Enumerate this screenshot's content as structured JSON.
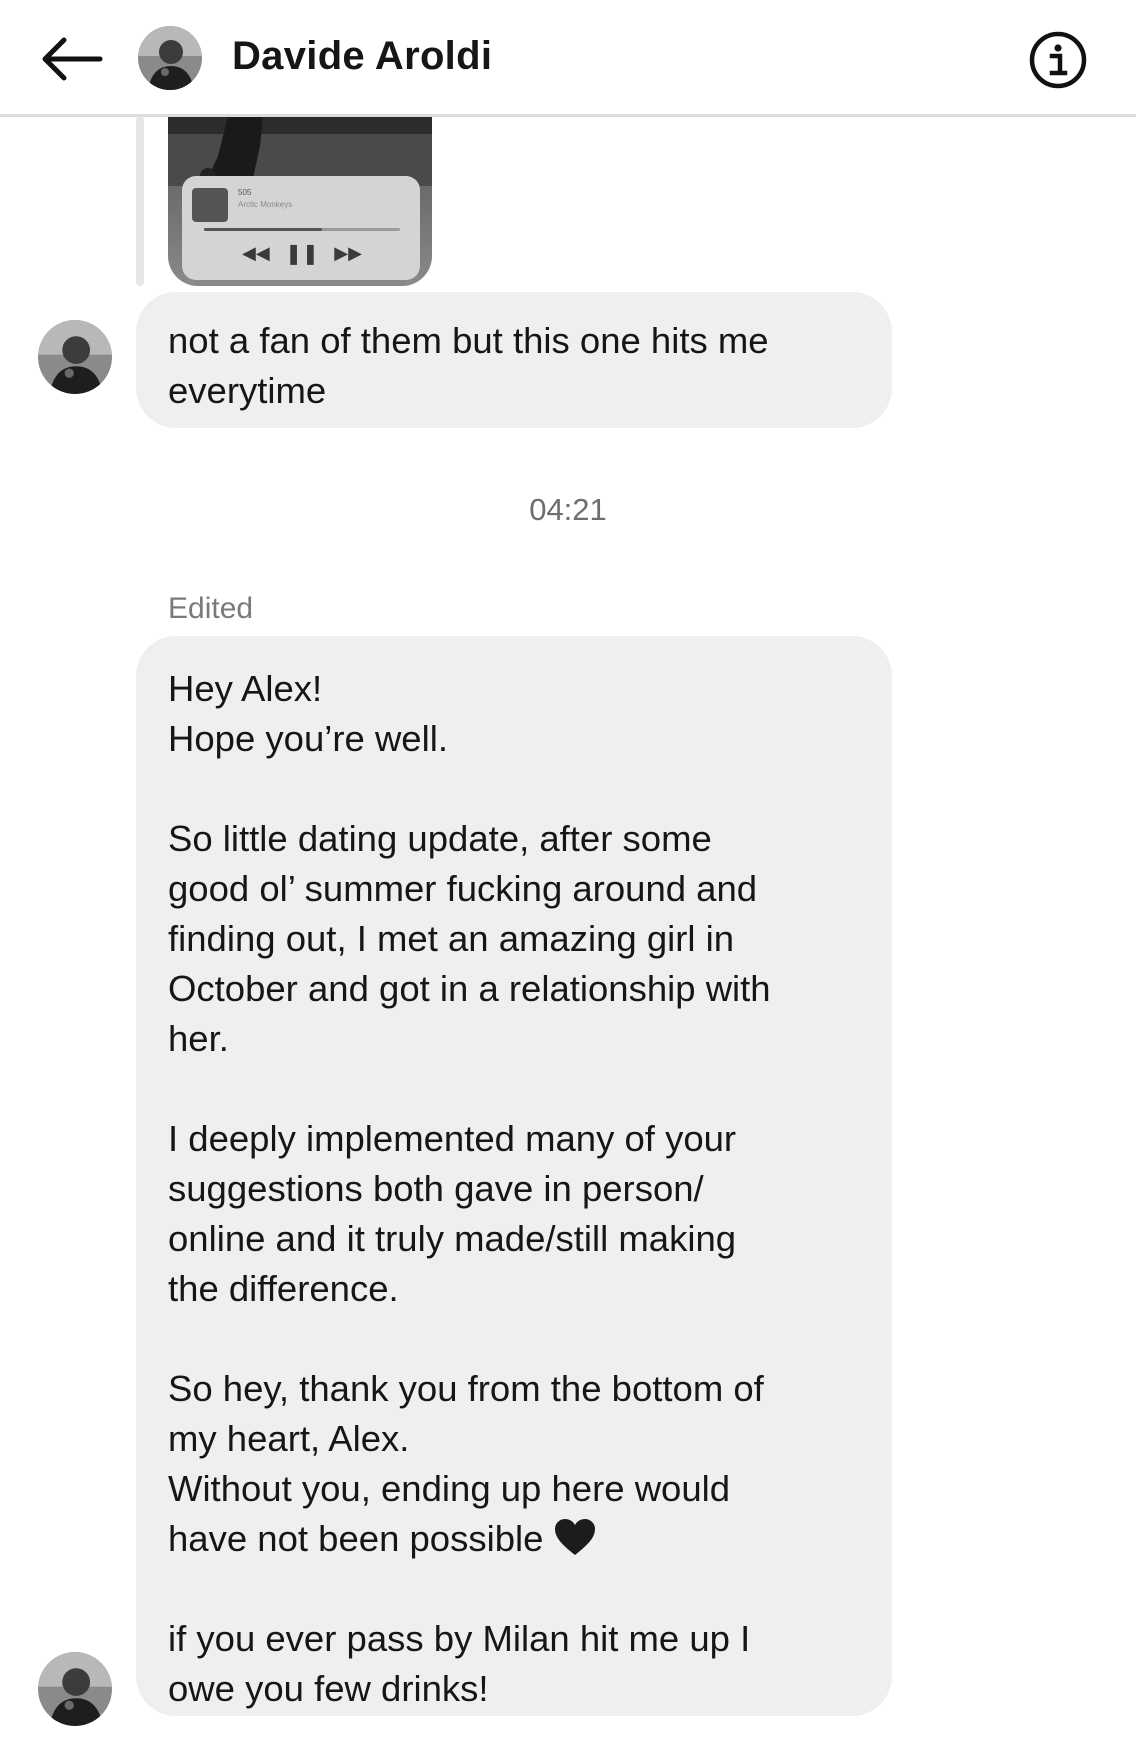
{
  "header": {
    "contact_name": "Davide Aroldi",
    "back_icon": "arrow-left-icon",
    "info_icon": "info-circle-icon"
  },
  "reply_preview": {
    "music_card": {
      "song_title": "505",
      "artist": "Arctic Monkeys",
      "progress": 0.6
    }
  },
  "messages": {
    "first": {
      "lines": [
        "not a fan of them but this one hits me",
        "everytime"
      ]
    },
    "timestamp": "04:21",
    "edited_label": "Edited",
    "second": {
      "paragraphs": [
        [
          "Hey Alex!",
          "Hope you’re well."
        ],
        [
          "So little dating update, after some",
          "good ol’ summer fucking around and",
          "finding out, I met an amazing girl in",
          "October and got in a relationship with",
          "her."
        ],
        [
          "I deeply implemented many of your",
          "suggestions both gave in person/",
          "online and it truly made/still making",
          "the difference."
        ],
        [
          "So hey, thank you from the bottom of",
          "my heart, Alex.",
          "Without you, ending up here would",
          "have not been possible"
        ],
        [
          "if you ever pass by Milan hit me up I",
          "owe you few drinks!"
        ]
      ],
      "emoji": "black-heart-icon"
    }
  },
  "colors": {
    "bubble_bg": "#efefef",
    "text": "#161616",
    "muted": "#6e6e6e",
    "divider": "#dcdcdc"
  }
}
